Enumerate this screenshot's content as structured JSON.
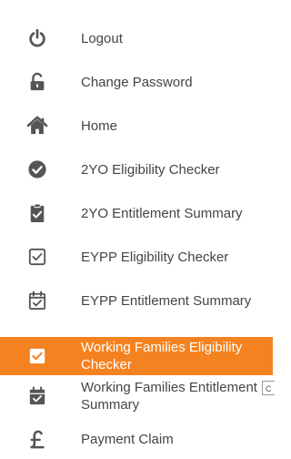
{
  "menu": {
    "items": [
      {
        "label": "Logout",
        "icon": "power-icon"
      },
      {
        "label": "Change Password",
        "icon": "unlock-icon"
      },
      {
        "label": "Home",
        "icon": "home-icon"
      },
      {
        "label": "2YO Eligibility Checker",
        "icon": "check-circle-icon"
      },
      {
        "label": "2YO Entitlement Summary",
        "icon": "clipboard-check-icon"
      },
      {
        "label": "EYPP Eligibility Checker",
        "icon": "check-square-icon"
      },
      {
        "label": "EYPP Entitlement Summary",
        "icon": "calendar-check-icon"
      },
      {
        "label": "Working Families Eligibility Checker",
        "icon": "check-square-icon",
        "active": true
      },
      {
        "label": "Working Families Entitlement Summary",
        "icon": "calendar-check-icon"
      },
      {
        "label": "Payment Claim",
        "icon": "pound-icon"
      }
    ]
  },
  "side_tab": {
    "label": "C"
  },
  "colors": {
    "accent": "#f58220",
    "icon": "#555555",
    "text": "#444444"
  }
}
